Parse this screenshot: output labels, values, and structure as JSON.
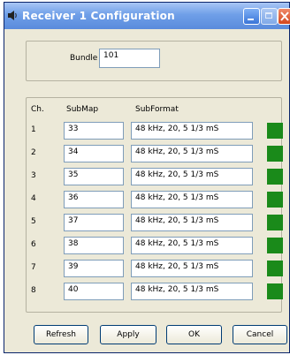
{
  "window": {
    "title": "Receiver 1 Configuration",
    "icon": "speaker-icon"
  },
  "bundle": {
    "label": "Bundle",
    "value": "101"
  },
  "table": {
    "headers": {
      "channel": "Ch.",
      "submap": "SubMap",
      "subformat": "SubFormat"
    },
    "rows": [
      {
        "ch": "1",
        "submap": "33",
        "subformat": "48 kHz, 20, 5 1/3 mS",
        "status": "active"
      },
      {
        "ch": "2",
        "submap": "34",
        "subformat": "48 kHz, 20, 5 1/3 mS",
        "status": "active"
      },
      {
        "ch": "3",
        "submap": "35",
        "subformat": "48 kHz, 20, 5 1/3 mS",
        "status": "active"
      },
      {
        "ch": "4",
        "submap": "36",
        "subformat": "48 kHz, 20, 5 1/3 mS",
        "status": "active"
      },
      {
        "ch": "5",
        "submap": "37",
        "subformat": "48 kHz, 20, 5 1/3 mS",
        "status": "active"
      },
      {
        "ch": "6",
        "submap": "38",
        "subformat": "48 kHz, 20, 5 1/3 mS",
        "status": "active"
      },
      {
        "ch": "7",
        "submap": "39",
        "subformat": "48 kHz, 20, 5 1/3 mS",
        "status": "active"
      },
      {
        "ch": "8",
        "submap": "40",
        "subformat": "48 kHz, 20, 5 1/3 mS",
        "status": "active"
      }
    ]
  },
  "buttons": {
    "refresh": "Refresh",
    "apply": "Apply",
    "ok": "OK",
    "cancel": "Cancel"
  },
  "colors": {
    "status_active": "#1a8a1a",
    "titlebar": "#6f9fe8"
  }
}
